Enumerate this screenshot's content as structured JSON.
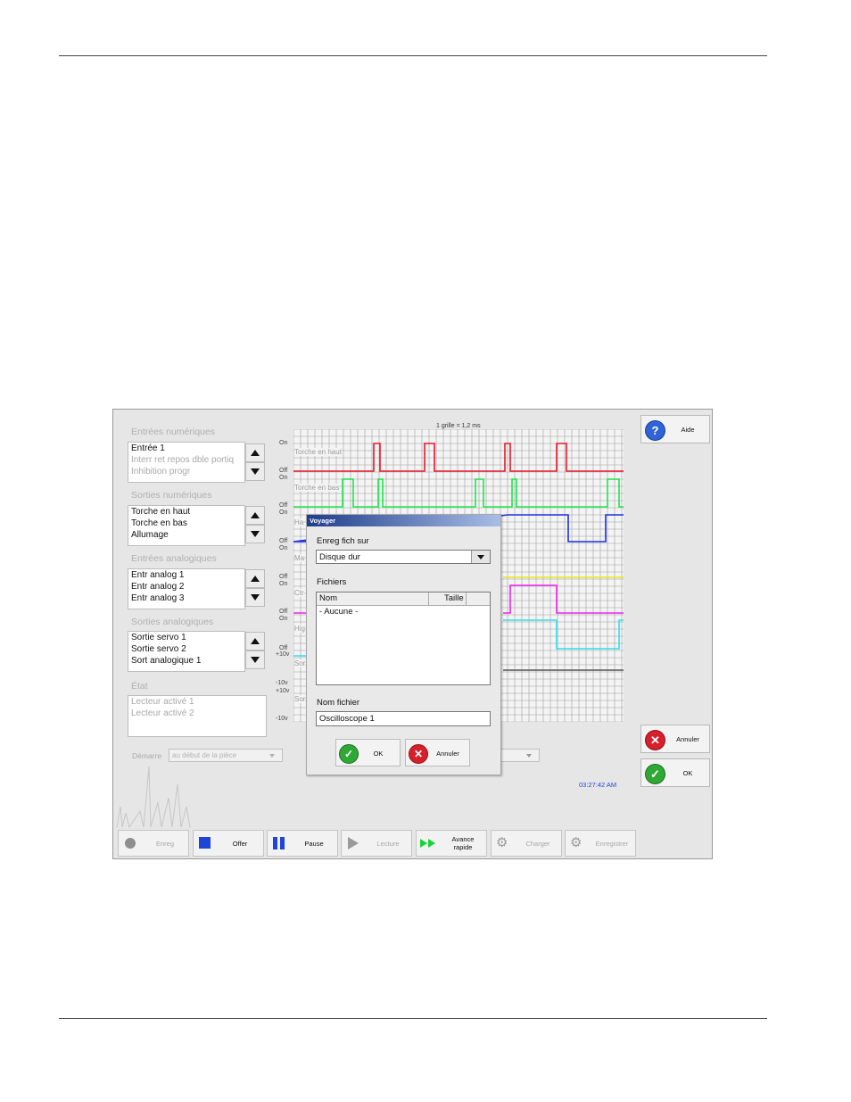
{
  "screen": {
    "groups": [
      {
        "title": "Entrées numériques",
        "items": [
          "Entrée 1",
          "Interr ret repos dble portiq",
          "Inhibition progr"
        ]
      },
      {
        "title": "Sorties numériques",
        "items": [
          "Torche en haut",
          "Torche en bas",
          "Allumage"
        ]
      },
      {
        "title": "Entrées analogiques",
        "items": [
          "Entr analog 1",
          "Entr analog 2",
          "Entr analog 3"
        ]
      },
      {
        "title": "Sorties analogiques",
        "items": [
          "Sortie servo 1",
          "Sortie servo 2",
          "Sort analogique 1"
        ]
      }
    ],
    "etat": {
      "title": "État",
      "items": [
        "Lecteur activé 1",
        "Lecteur activé 2"
      ]
    },
    "demarre": {
      "label": "Démarre",
      "value": "au début de la pièce"
    },
    "grid_caption": "1 grille = 1,2 ms",
    "axis_labels": [
      "On",
      "Off",
      "On",
      "Off",
      "On",
      "Off",
      "On",
      "Off",
      "On",
      "Off",
      "On",
      "Off",
      "+10v",
      "-10v",
      "+10v",
      "-10v"
    ],
    "trace_labels": [
      "Torche en haut",
      "Torche en bas",
      "Ha",
      "Ma",
      "Ctr",
      "Hig",
      "Sor",
      "Sor"
    ],
    "time": "03:27:42 AM",
    "side": {
      "aide": "Aide",
      "annuler": "Annuler",
      "ok": "OK"
    },
    "controls": [
      "Enreg",
      "Offer",
      "Pause",
      "Lecture",
      "Avance rapide",
      "Charger",
      "Enregistrer"
    ],
    "colors": {
      "red": "#e8192c",
      "green": "#19e84a",
      "blue": "#1a30e0",
      "yellow": "#e6e619",
      "magenta": "#ee22ee",
      "cyan": "#2ee0ee"
    }
  },
  "dialog": {
    "title": "Voyager",
    "save_on_label": "Enreg fich sur",
    "save_on_value": "Disque dur",
    "files_label": "Fichiers",
    "columns": [
      "Nom",
      "Taille"
    ],
    "rows": [
      "- Aucune -"
    ],
    "filename_label": "Nom fichier",
    "filename_value": "Oscilloscope 1",
    "ok": "OK",
    "cancel": "Annuler"
  }
}
